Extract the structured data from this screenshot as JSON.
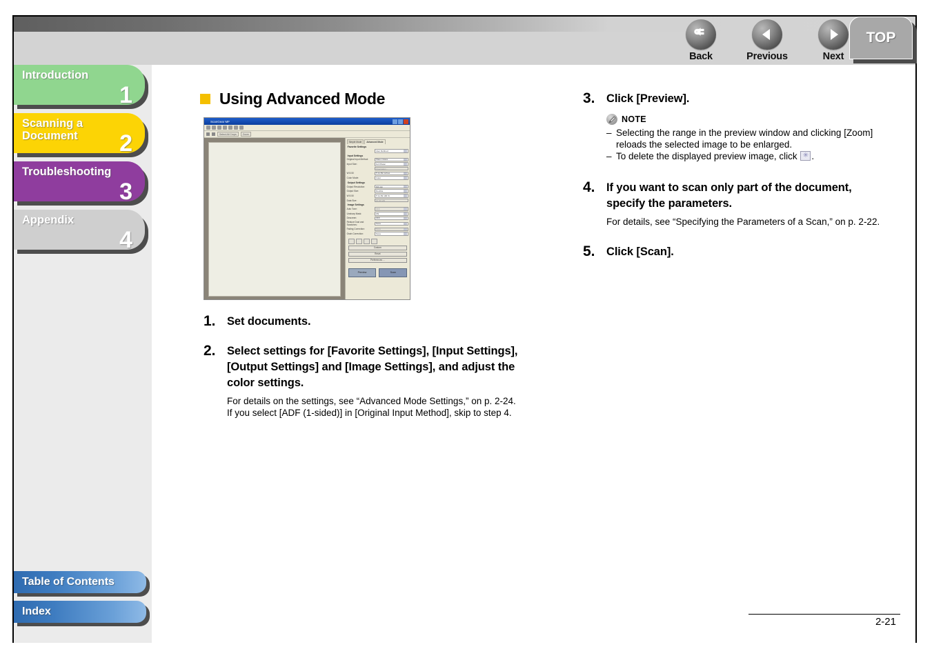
{
  "header": {
    "nav_buttons": [
      {
        "label": "Back",
        "icon": "back-arrow-icon"
      },
      {
        "label": "Previous",
        "icon": "left-triangle-icon"
      },
      {
        "label": "Next",
        "icon": "right-triangle-icon"
      }
    ],
    "top_tab_label": "TOP"
  },
  "sidebar": {
    "chapters": [
      {
        "label": "Introduction",
        "number": "1",
        "color": "#90d68f"
      },
      {
        "label": "Scanning a\nDocument",
        "number": "2",
        "color": "#fcd405"
      },
      {
        "label": "Troubleshooting",
        "number": "3",
        "color": "#8f3d9e"
      },
      {
        "label": "Appendix",
        "number": "4",
        "color": "#cfcfcf"
      }
    ],
    "bottom_links": [
      {
        "label": "Table of Contents"
      },
      {
        "label": "Index"
      }
    ]
  },
  "main": {
    "section_title": "Using Advanced Mode",
    "bullet_color": "#f4bf00",
    "figure": {
      "window_title": "ScanGear MF",
      "tabs": [
        "Simple Mode",
        "Advanced Mode"
      ],
      "active_tab": "Advanced Mode",
      "toolbar_buttons": [
        "Select All Crops",
        "Zoom"
      ],
      "groups": [
        {
          "name": "Favorite Settings",
          "rows": [
            {
              "label": "",
              "value": "User Defined"
            }
          ]
        },
        {
          "name": "Input Settings",
          "rows": [
            {
              "label": "Original Input Method:",
              "value": "Platen Glass"
            },
            {
              "label": "Input Size:",
              "value": "Full Platen"
            },
            {
              "label": "",
              "value": "Orientation..."
            },
            {
              "label": "W 8.50",
              "value": "H 11.69  Inches"
            },
            {
              "label": "Color Mode:",
              "value": "Color"
            }
          ]
        },
        {
          "name": "Output Settings",
          "rows": [
            {
              "label": "Output Resolution:",
              "value": "300  dpi"
            },
            {
              "label": "Output Size:",
              "value": "Flexible"
            },
            {
              "label": "W 8.50",
              "value": "H 11.69   100  %"
            },
            {
              "label": "Data Size:",
              "value": "25.58 MB"
            }
          ]
        },
        {
          "name": "Image Settings",
          "rows": [
            {
              "label": "Auto Tone:",
              "value": "OFF"
            },
            {
              "label": "Unsharp Mask:",
              "value": "ON"
            },
            {
              "label": "Descreen:",
              "value": "OFF"
            },
            {
              "label": "Reduce Dust and Scratches:",
              "value": "None"
            },
            {
              "label": "Fading Correction:",
              "value": "None"
            },
            {
              "label": "Grain Correction:",
              "value": "None"
            }
          ]
        }
      ],
      "preset_value": "Custom",
      "reset_label": "Reset",
      "preferences_label": "Preferences ...",
      "preview_button": "Preview",
      "scan_button": "Scan"
    },
    "steps_left": [
      {
        "num": "1.",
        "title": "Set documents.",
        "desc": ""
      },
      {
        "num": "2.",
        "title": "Select settings for [Favorite Settings], [Input Settings], [Output Settings] and [Image Settings], and adjust the color settings.",
        "desc": "For details on the settings, see “Advanced Mode Settings,” on p. 2-24.\nIf you select [ADF (1-sided)] in [Original Input Method], skip to step 4."
      }
    ],
    "steps_right": [
      {
        "num": "3.",
        "title": "Click [Preview].",
        "desc": ""
      },
      {
        "num": "4.",
        "title": "If you want to scan only part of the document, specify the parameters.",
        "desc": "For details, see “Specifying the Parameters of a Scan,” on p. 2-22."
      },
      {
        "num": "5.",
        "title": "Click [Scan].",
        "desc": ""
      }
    ],
    "note": {
      "label": "NOTE",
      "items": [
        {
          "dash": "–",
          "text_before": "Selecting the range in the preview window and clicking [Zoom] reloads the selected image to be enlarged.",
          "has_icon": false,
          "text_after": ""
        },
        {
          "dash": "–",
          "text_before": "To delete the displayed preview image, click ",
          "has_icon": true,
          "text_after": "."
        }
      ]
    }
  },
  "footer": {
    "page_number": "2-21"
  }
}
